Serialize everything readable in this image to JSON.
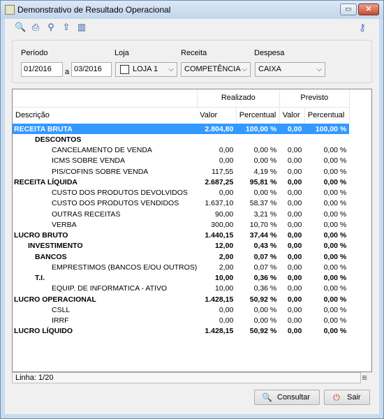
{
  "window": {
    "title": "Demonstrativo de Resultado Operacional"
  },
  "filters": {
    "periodo_label": "Período",
    "periodo_from": "01/2016",
    "periodo_sep": "a",
    "periodo_to": "03/2016",
    "loja_label": "Loja",
    "loja_value": "LOJA 1",
    "receita_label": "Receita",
    "receita_value": "COMPETÊNCIA",
    "despesa_label": "Despesa",
    "despesa_value": "CAIXA"
  },
  "grid": {
    "group_realizado": "Realizado",
    "group_previsto": "Previsto",
    "columns": [
      "Descrição",
      "Valor",
      "Percentual",
      "Valor",
      "Percentual"
    ],
    "rows": [
      {
        "desc": "RECEITA BRUTA",
        "level": 0,
        "bold": true,
        "selected": true,
        "v1": "2.804,80",
        "p1": "100,00 %",
        "v2": "0,00",
        "p2": "100,00 %"
      },
      {
        "desc": "DESCONTOS",
        "level": 2,
        "bold": true,
        "v1": "",
        "p1": "",
        "v2": "",
        "p2": ""
      },
      {
        "desc": "CANCELAMENTO DE VENDA",
        "level": 3,
        "v1": "0,00",
        "p1": "0,00 %",
        "v2": "0,00",
        "p2": "0,00 %"
      },
      {
        "desc": "ICMS SOBRE VENDA",
        "level": 3,
        "v1": "0,00",
        "p1": "0,00 %",
        "v2": "0,00",
        "p2": "0,00 %"
      },
      {
        "desc": "PIS/COFINS SOBRE VENDA",
        "level": 3,
        "v1": "117,55",
        "p1": "4,19 %",
        "v2": "0,00",
        "p2": "0,00 %"
      },
      {
        "desc": "RECEITA LÍQUIDA",
        "level": 0,
        "bold": true,
        "v1": "2.687,25",
        "p1": "95,81 %",
        "v2": "0,00",
        "p2": "0,00 %"
      },
      {
        "desc": "CUSTO DOS PRODUTOS DEVOLVIDOS",
        "level": 3,
        "v1": "0,00",
        "p1": "0,00 %",
        "v2": "0,00",
        "p2": "0,00 %"
      },
      {
        "desc": "CUSTO DOS PRODUTOS VENDIDOS",
        "level": 3,
        "v1": "1.637,10",
        "p1": "58,37 %",
        "v2": "0,00",
        "p2": "0,00 %"
      },
      {
        "desc": "OUTRAS RECEITAS",
        "level": 3,
        "v1": "90,00",
        "p1": "3,21 %",
        "v2": "0,00",
        "p2": "0,00 %"
      },
      {
        "desc": "VERBA",
        "level": 3,
        "v1": "300,00",
        "p1": "10,70 %",
        "v2": "0,00",
        "p2": "0,00 %"
      },
      {
        "desc": "LUCRO BRUTO",
        "level": 0,
        "bold": true,
        "v1": "1.440,15",
        "p1": "37,44 %",
        "v2": "0,00",
        "p2": "0,00 %"
      },
      {
        "desc": "INVESTIMENTO",
        "level": 1,
        "bold": true,
        "v1": "12,00",
        "p1": "0,43 %",
        "v2": "0,00",
        "p2": "0,00 %"
      },
      {
        "desc": "BANCOS",
        "level": 2,
        "bold": true,
        "v1": "2,00",
        "p1": "0,07 %",
        "v2": "0,00",
        "p2": "0,00 %"
      },
      {
        "desc": "EMPRESTIMOS (BANCOS E/OU OUTROS)",
        "level": 3,
        "v1": "2,00",
        "p1": "0,07 %",
        "v2": "0,00",
        "p2": "0,00 %"
      },
      {
        "desc": "T.I.",
        "level": 2,
        "bold": true,
        "v1": "10,00",
        "p1": "0,36 %",
        "v2": "0,00",
        "p2": "0,00 %"
      },
      {
        "desc": "EQUIP. DE INFORMATICA - ATIVO",
        "level": 3,
        "v1": "10,00",
        "p1": "0,36 %",
        "v2": "0,00",
        "p2": "0,00 %"
      },
      {
        "desc": "LUCRO OPERACIONAL",
        "level": 0,
        "bold": true,
        "v1": "1.428,15",
        "p1": "50,92 %",
        "v2": "0,00",
        "p2": "0,00 %"
      },
      {
        "desc": "CSLL",
        "level": 3,
        "v1": "0,00",
        "p1": "0,00 %",
        "v2": "0,00",
        "p2": "0,00 %"
      },
      {
        "desc": "IRRF",
        "level": 3,
        "v1": "0,00",
        "p1": "0,00 %",
        "v2": "0,00",
        "p2": "0,00 %"
      },
      {
        "desc": "LUCRO LÍQUIDO",
        "level": 0,
        "bold": true,
        "v1": "1.428,15",
        "p1": "50,92 %",
        "v2": "0,00",
        "p2": "0,00 %"
      }
    ]
  },
  "status": {
    "linha": "Linha: 1/20"
  },
  "buttons": {
    "consultar": "Consultar",
    "sair": "Sair"
  },
  "icons": {
    "toolbar": [
      "preview-icon",
      "print-icon",
      "filter-icon",
      "export-icon",
      "chart-icon"
    ],
    "search": "key-icon"
  },
  "colors": {
    "selection": "#3399ff",
    "sair_icon": "#d9321f"
  }
}
